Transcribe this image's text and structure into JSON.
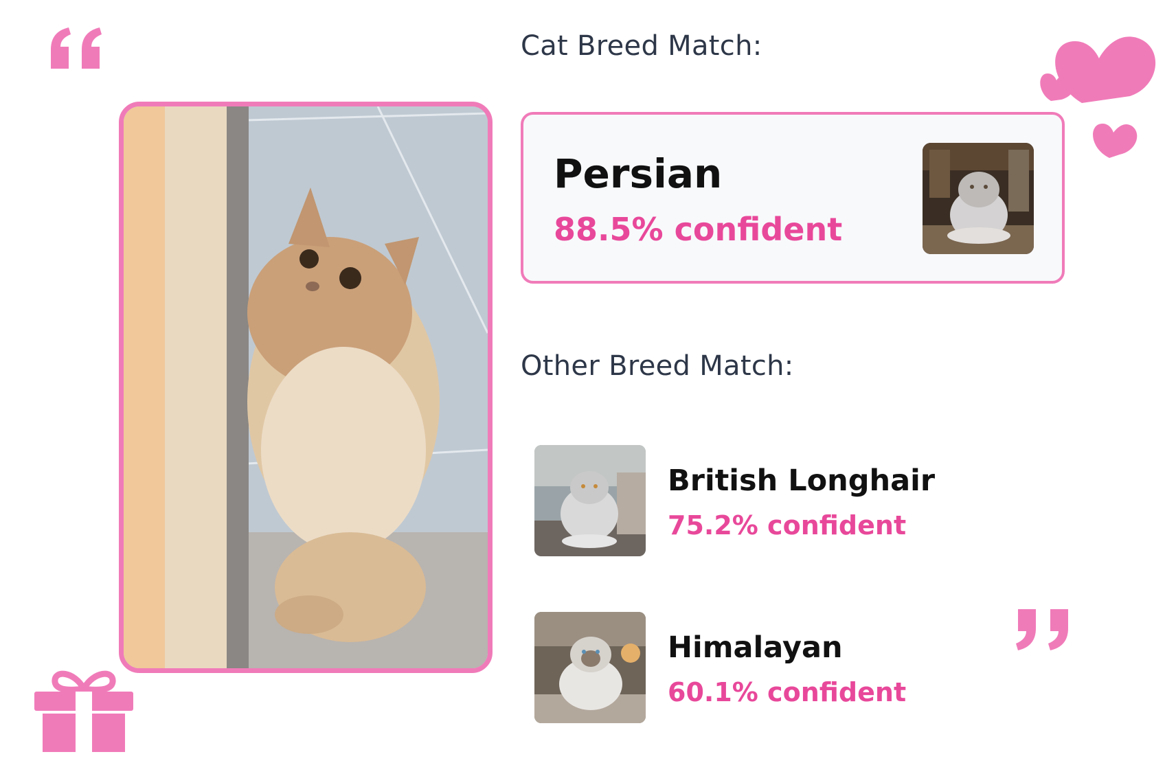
{
  "headings": {
    "top_match": "Cat Breed Match:",
    "other_matches": "Other Breed Match:"
  },
  "top_match": {
    "name": "Persian",
    "confidence": "88.5% confident"
  },
  "other_matches": [
    {
      "name": "British Longhair",
      "confidence": "75.2% confident"
    },
    {
      "name": "Himalayan",
      "confidence": "60.1% confident"
    }
  ],
  "icons": {
    "quote_open": "quote-open-icon",
    "quote_close": "quote-close-icon",
    "hearts": "hearts-icon",
    "gift": "gift-icon"
  },
  "colors": {
    "accent": "#f07bb9",
    "confidence": "#e8489a",
    "heading": "#2d3748",
    "title": "#111111"
  }
}
